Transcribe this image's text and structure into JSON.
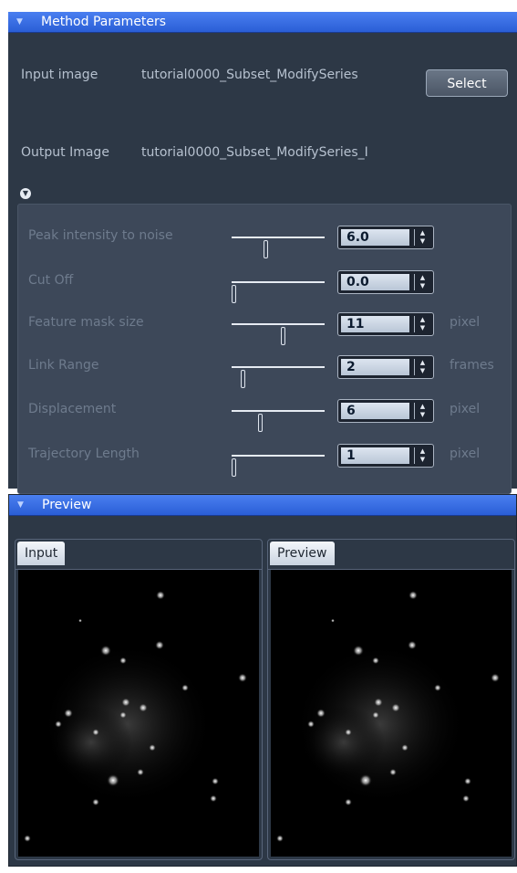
{
  "method_panel": {
    "title": "Method Parameters",
    "input_label": "Input image",
    "input_value": "tutorial0000_Subset_ModifySeries",
    "select_button": "Select",
    "output_label": "Output Image",
    "output_value": "tutorial0000_Subset_ModifySeries_I"
  },
  "params": [
    {
      "label": "Peak intensity to noise",
      "value": "6.0",
      "unit": "",
      "slider": 0.36
    },
    {
      "label": "Cut Off",
      "value": "0.0",
      "unit": "",
      "slider": 0.0
    },
    {
      "label": "Feature mask size",
      "value": "11",
      "unit": "pixel",
      "slider": 0.56
    },
    {
      "label": "Link Range",
      "value": "2",
      "unit": "frames",
      "slider": 0.1
    },
    {
      "label": "Displacement",
      "value": "6",
      "unit": "pixel",
      "slider": 0.3
    },
    {
      "label": "Trajectory Length",
      "value": "1",
      "unit": "pixel",
      "slider": 0.0
    }
  ],
  "preview_panel": {
    "title": "Preview",
    "input_tab": "Input",
    "preview_tab": "Preview"
  },
  "colors": {
    "header": "#2f62d8",
    "panel_bg": "#2d3846",
    "param_bg": "#3d4859"
  }
}
